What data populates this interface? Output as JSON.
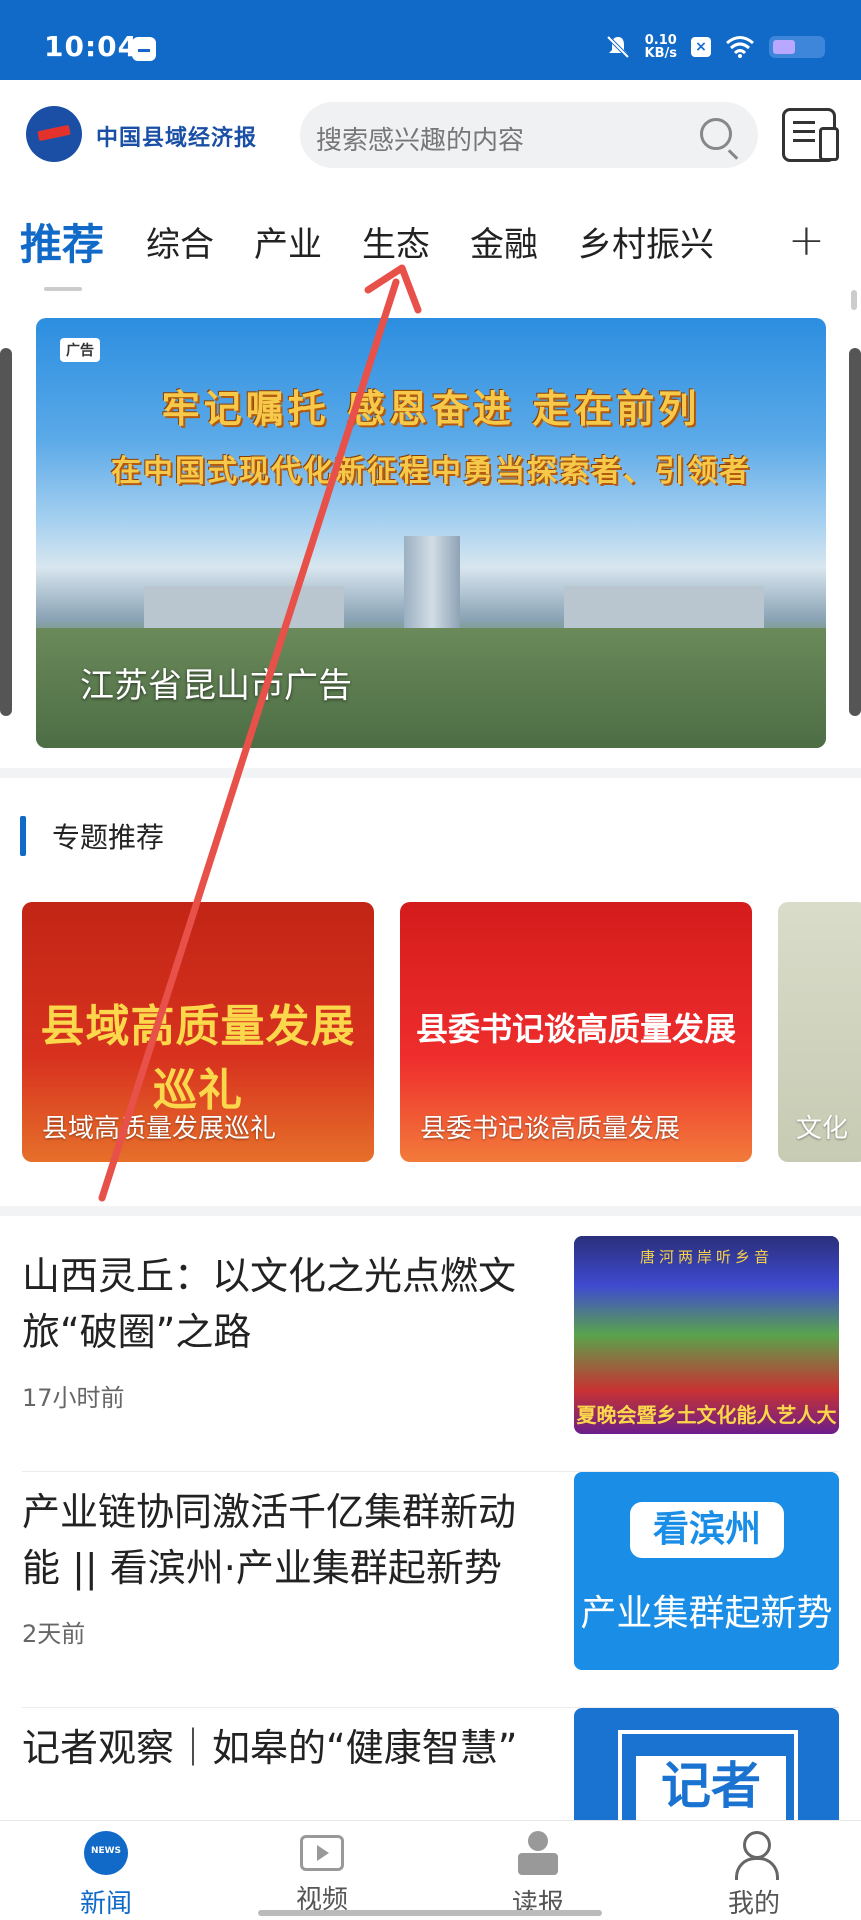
{
  "status_bar": {
    "time": "10:04",
    "net_speed_value": "0.10",
    "net_speed_unit": "KB/s"
  },
  "header": {
    "logo_text": "中国县域经济报",
    "search_placeholder": "搜索感兴趣的内容"
  },
  "tabs": {
    "items": [
      "推荐",
      "综合",
      "产业",
      "生态",
      "金融",
      "乡村振兴"
    ],
    "active_index": 0,
    "add_label": "+"
  },
  "banner": {
    "ad_tag": "广告",
    "headline_1": "牢记嘱托 感恩奋进 走在前列",
    "headline_2": "在中国式现代化新征程中勇当探索者、引领者",
    "caption": "江苏省昆山市广告"
  },
  "topics": {
    "title": "专题推荐",
    "cards": [
      {
        "art_text": "县域高质量发展巡礼",
        "label": "县域高质量发展巡礼"
      },
      {
        "art_text": "县委书记谈高质量发展",
        "label": "县委书记谈高质量发展"
      },
      {
        "art_text": "",
        "label": "文化"
      }
    ]
  },
  "news": [
    {
      "title": "山西灵丘：以文化之光点燃文旅“破圈”之路",
      "time": "17小时前",
      "thumb_top": "唐河两岸听乡音",
      "thumb_band": "夏晚会暨乡土文化能人艺人大"
    },
    {
      "title": "产业链协同激活千亿集群新动能 || 看滨州·产业集群起新势",
      "time": "2天前",
      "thumb_pill": "看滨州",
      "thumb_sub": "产业集群起新势"
    },
    {
      "title": "记者观察｜如皋的“健康智慧”",
      "time": "",
      "thumb_text": "记者"
    }
  ],
  "bottom_nav": {
    "items": [
      {
        "label": "新闻",
        "icon": "news-icon"
      },
      {
        "label": "视频",
        "icon": "video-icon"
      },
      {
        "label": "读报",
        "icon": "read-newspaper-icon"
      },
      {
        "label": "我的",
        "icon": "profile-icon"
      }
    ],
    "active_index": 0
  },
  "colors": {
    "brand_blue": "#1169c8",
    "gesture_red": "#e8504a"
  }
}
